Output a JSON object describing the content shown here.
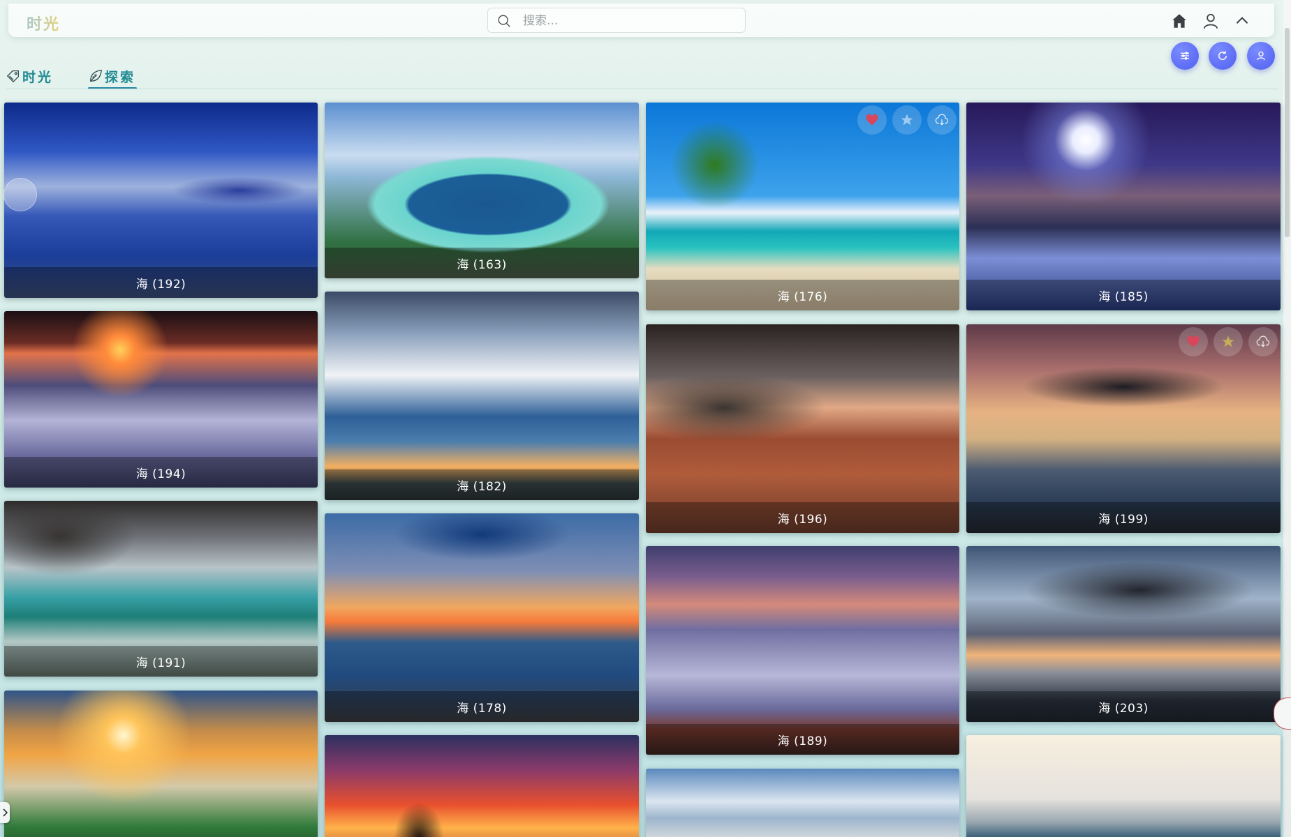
{
  "app": {
    "logo": "时光"
  },
  "search": {
    "placeholder": "搜索..."
  },
  "toolbar": {
    "icons": [
      "home-icon",
      "user-icon",
      "chevron-up-icon"
    ]
  },
  "fabs": [
    "sliders-icon",
    "refresh-icon",
    "user-icon"
  ],
  "tabs": [
    {
      "label": "时光",
      "icon": "tag-icon",
      "active": false
    },
    {
      "label": "探索",
      "icon": "leaf-icon",
      "active": true
    }
  ],
  "cards": [
    {
      "caption": "海 (192)"
    },
    {
      "caption": "海 (163)"
    },
    {
      "caption": "海 (176)"
    },
    {
      "caption": "海 (185)"
    },
    {
      "caption": "海 (194)"
    },
    {
      "caption": "海 (182)"
    },
    {
      "caption": "海 (196)"
    },
    {
      "caption": "海 (199)"
    },
    {
      "caption": "海 (191)"
    },
    {
      "caption": "海 (178)"
    },
    {
      "caption": "海 (189)"
    },
    {
      "caption": "海 (203)"
    }
  ],
  "colors": {
    "accent": "#1f8a92",
    "fab": "#5b6cf5",
    "favorite": "#d9455a"
  }
}
